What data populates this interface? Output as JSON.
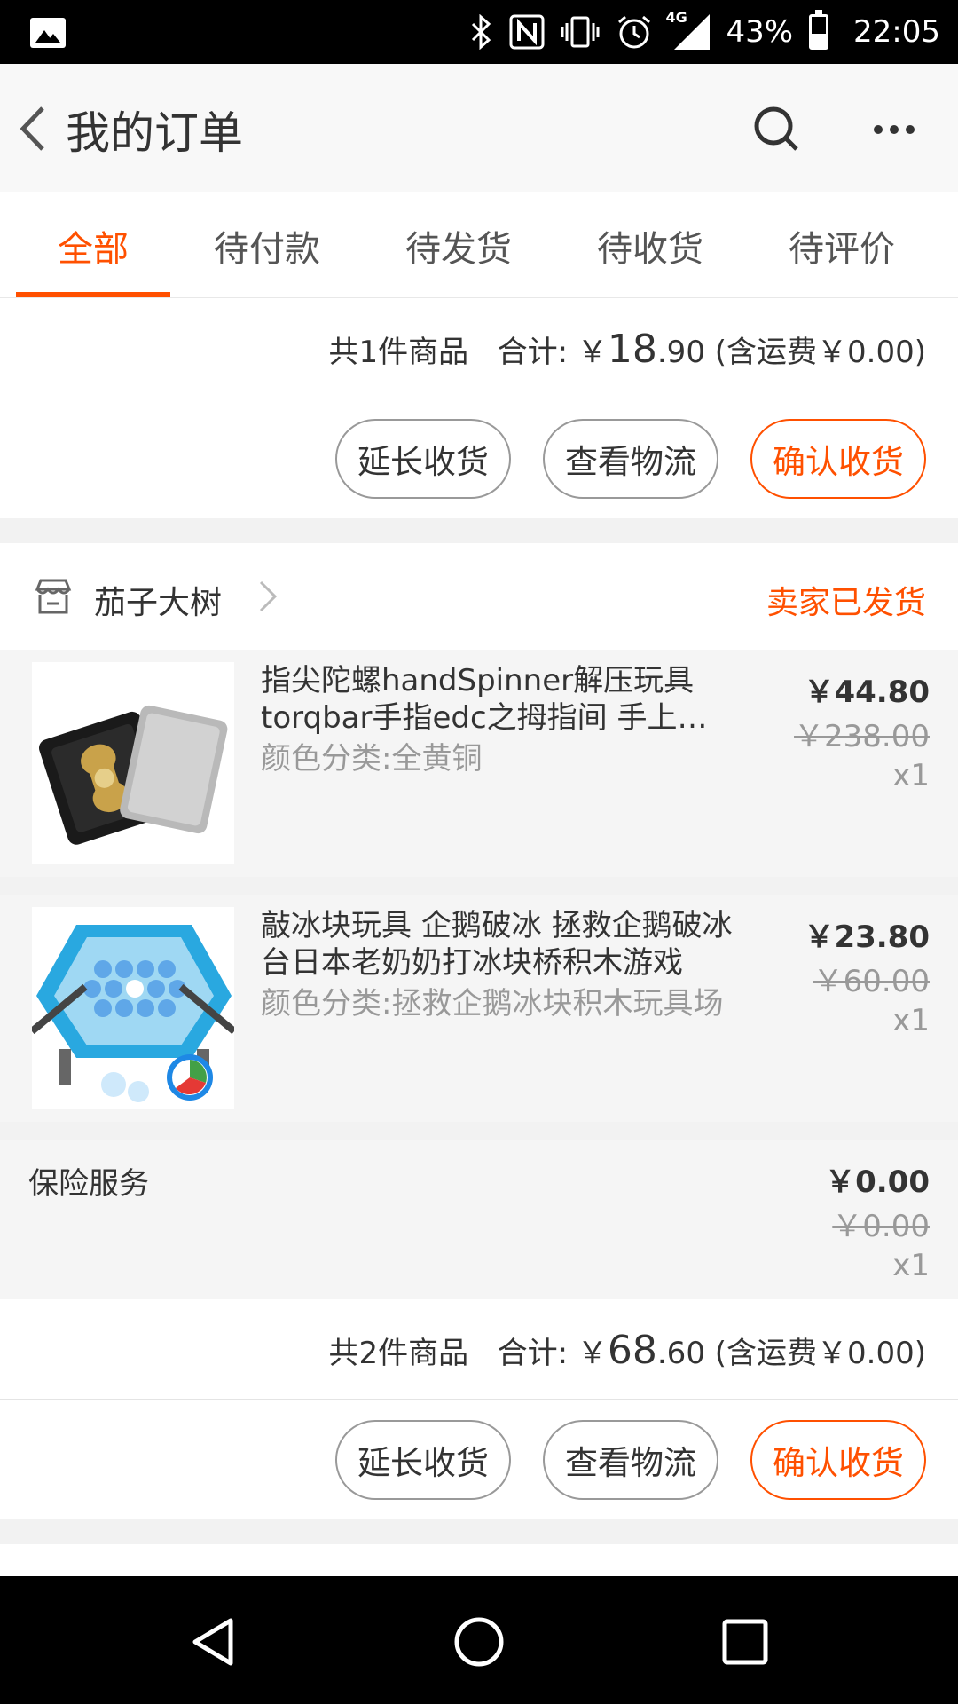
{
  "status_bar": {
    "network": "4G",
    "battery": "43%",
    "battery_level": 0.43,
    "time": "22:05",
    "icons": [
      "gallery-icon",
      "bluetooth-icon",
      "nfc-icon",
      "vibrate-icon",
      "alarm-icon",
      "signal-icon",
      "battery-icon"
    ]
  },
  "header": {
    "title": "我的订单"
  },
  "tabs": [
    {
      "label": "全部",
      "active": true
    },
    {
      "label": "待付款",
      "active": false
    },
    {
      "label": "待发货",
      "active": false
    },
    {
      "label": "待收货",
      "active": false
    },
    {
      "label": "待评价",
      "active": false
    }
  ],
  "order1": {
    "count_text": "共1件商品",
    "total_label": "合计:",
    "total_currency": "￥",
    "total_int": "18",
    "total_dec": ".90",
    "shipping_text": "(含运费￥0.00)",
    "buttons": {
      "extend": "延长收货",
      "logistics": "查看物流",
      "confirm": "确认收货"
    }
  },
  "order2": {
    "shop_name": "茄子大树",
    "status": "卖家已发货",
    "items": [
      {
        "title": "指尖陀螺handSpinner解压玩具torqbar手指edc之拇指间 手上…",
        "sku": "颜色分类:全黄铜",
        "price": "￥44.80",
        "orig_price": "￥238.00",
        "qty": "x1"
      },
      {
        "title": "敲冰块玩具 企鹅破冰 拯救企鹅破冰台日本老奶奶打冰块桥积木游戏",
        "sku": "颜色分类:拯救企鹅冰块积木玩具场",
        "price": "￥23.80",
        "orig_price": "￥60.00",
        "qty": "x1"
      }
    ],
    "insurance": {
      "label": "保险服务",
      "price": "￥0.00",
      "orig_price": "￥0.00",
      "qty": "x1"
    },
    "count_text": "共2件商品",
    "total_label": "合计:",
    "total_currency": "￥",
    "total_int": "68",
    "total_dec": ".60",
    "shipping_text": "(含运费￥0.00)",
    "buttons": {
      "extend": "延长收货",
      "logistics": "查看物流",
      "confirm": "确认收货"
    }
  },
  "colors": {
    "accent": "#ff5000",
    "text": "#333333",
    "muted": "#999999",
    "bg": "#f2f2f2"
  }
}
